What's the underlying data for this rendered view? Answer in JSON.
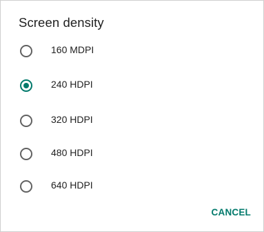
{
  "dialog": {
    "title": "Screen density",
    "options": [
      {
        "label": "160 MDPI",
        "selected": false
      },
      {
        "label": "240 HDPI",
        "selected": true
      },
      {
        "label": "320 HDPI",
        "selected": false
      },
      {
        "label": "480 HDPI",
        "selected": false
      },
      {
        "label": "640 HDPI",
        "selected": false
      }
    ],
    "cancel_label": "CANCEL"
  },
  "colors": {
    "accent": "#00796b",
    "text": "#212121",
    "radio_unchecked": "#616161"
  }
}
